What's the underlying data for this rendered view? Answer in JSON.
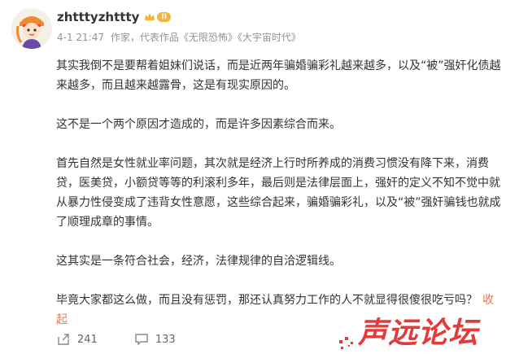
{
  "post": {
    "author": "zhtttyzhttty",
    "level_badge": "II",
    "meta": {
      "time": "4-1 21:47",
      "role": "作家，代表作品",
      "work1": "《无限恐怖》",
      "work2": "《大宇宙时代》"
    },
    "paragraphs": [
      "其实我倒不是要帮着姐妹们说话，而是近两年骗婚骗彩礼越来越多，以及“被”强奸化债越来越多，而且越来越露骨，这是有现实原因的。",
      "这不是一个两个原因才造成的，而是许多因素综合而来。",
      "首先自然是女性就业率问题，其次就是经济上行时所养成的消费习惯没有降下来，消费贷，医美贷，小额贷等等的利滚利多年，最后则是法律层面上，强奸的定义不知不觉中就从暴力性侵变成了违背女性意愿，这些综合起来，骗婚骗彩礼，以及“被”强奸骗钱也就成了顺理成章的事情。",
      "这其实是一条符合社会，经济，法律规律的自洽逻辑线。",
      "毕竟大家都这么做，而且没有惩罚，那还认真努力工作的人不就显得很傻很吃亏吗？"
    ],
    "collapse_label": "收起"
  },
  "actions": {
    "repost_count": "241",
    "comment_count": "133"
  },
  "watermark": {
    "text": "声远论坛"
  },
  "colors": {
    "accent": "#eb7350",
    "muted": "#939393",
    "badge": "#f2b43a",
    "watermark": "#e23b3b"
  }
}
